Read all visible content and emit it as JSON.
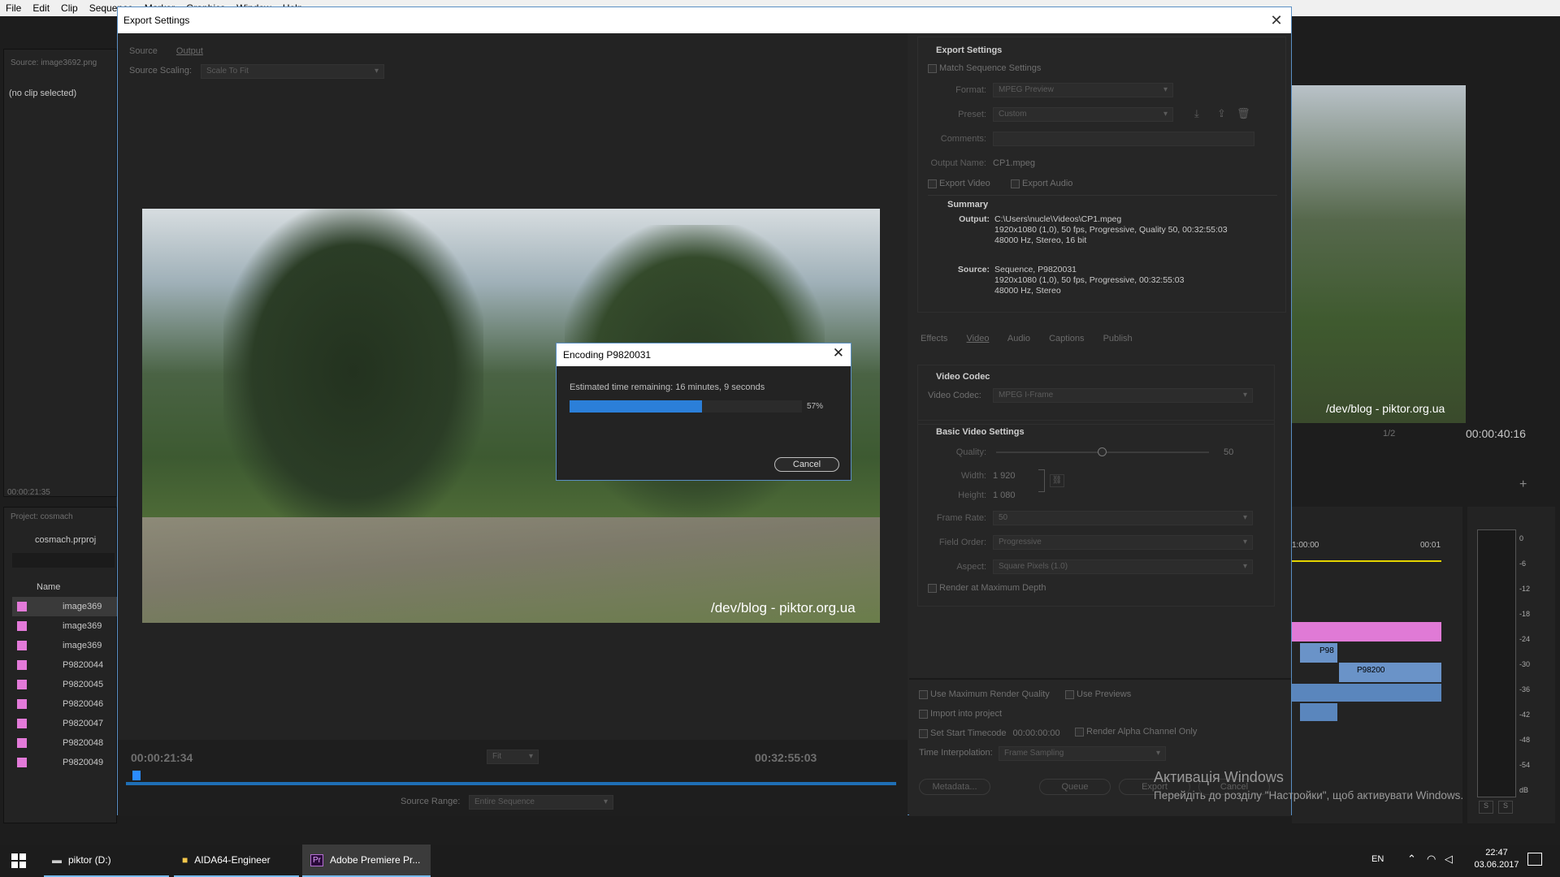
{
  "menubar": {
    "items": [
      "File",
      "Edit",
      "Clip",
      "Sequence",
      "Marker",
      "Graphics",
      "Window",
      "Help"
    ]
  },
  "background": {
    "source_label": "Source: image3692.png",
    "no_clip": "(no clip selected)",
    "left_timecode": "00:00:21:35",
    "project_label": "Project: cosmach",
    "project_file": "cosmach.prproj",
    "name_header": "Name",
    "files": [
      "image369",
      "image369",
      "image369",
      "P9820044",
      "P9820045",
      "P9820046",
      "P9820047",
      "P9820048",
      "P9820049"
    ],
    "program_timecode": "00:00:40:16",
    "program_scale": "1/2",
    "timeline_start": "1:00:00",
    "timeline_end": "00:01",
    "clip_labels": [
      "P98",
      "P98200"
    ],
    "meter_ticks": [
      "0",
      "-6",
      "-12",
      "-18",
      "-24",
      "-30",
      "-36",
      "-42",
      "-48",
      "-54",
      "dB"
    ],
    "meter_buttons": [
      "S",
      "S"
    ]
  },
  "export_dialog": {
    "title": "Export Settings",
    "tabs": [
      "Source",
      "Output"
    ],
    "source_scaling_label": "Source Scaling:",
    "source_scaling_value": "Scale To Fit",
    "preview_watermark": "/dev/blog - piktor.org.ua",
    "current_timecode": "00:00:21:34",
    "fit_label": "Fit",
    "end_timecode": "00:32:55:03",
    "source_range_label": "Source Range:",
    "source_range_value": "Entire Sequence",
    "settings": {
      "section_title": "Export Settings",
      "match_sequence": "Match Sequence Settings",
      "format_label": "Format:",
      "format_value": "MPEG Preview",
      "preset_label": "Preset:",
      "preset_value": "Custom",
      "comments_label": "Comments:",
      "output_name_label": "Output Name:",
      "output_name_value": "CP1.mpeg",
      "export_video": "Export Video",
      "export_audio": "Export Audio",
      "summary_title": "Summary",
      "output_label": "Output:",
      "output_lines": [
        "C:\\Users\\nucle\\Videos\\CP1.mpeg",
        "1920x1080 (1,0), 50 fps, Progressive, Quality 50, 00:32:55:03",
        "48000 Hz, Stereo, 16 bit"
      ],
      "source_label": "Source:",
      "source_lines": [
        "Sequence, P9820031",
        "1920x1080 (1,0), 50 fps, Progressive, 00:32:55:03",
        "48000 Hz, Stereo"
      ]
    },
    "codec_tabs": [
      "Effects",
      "Video",
      "Audio",
      "Captions",
      "Publish"
    ],
    "video_codec_title": "Video Codec",
    "video_codec_label": "Video Codec:",
    "video_codec_value": "MPEG I-Frame",
    "basic_title": "Basic Video Settings",
    "quality_label": "Quality:",
    "quality_value": "50",
    "quality_level": 0.5,
    "width_label": "Width:",
    "width_value": "1 920",
    "height_label": "Height:",
    "height_value": "1 080",
    "frame_rate_label": "Frame Rate:",
    "frame_rate_value": "50",
    "field_order_label": "Field Order:",
    "field_order_value": "Progressive",
    "aspect_label": "Aspect:",
    "aspect_value": "Square Pixels (1.0)",
    "render_max_depth": "Render at Maximum Depth",
    "use_max_render": "Use Maximum Render Quality",
    "use_previews": "Use Previews",
    "import_project": "Import into project",
    "set_start_tc": "Set Start Timecode",
    "start_tc_value": "00:00:00:00",
    "render_alpha": "Render Alpha Channel Only",
    "time_interp_label": "Time Interpolation:",
    "time_interp_value": "Frame Sampling",
    "metadata_btn": "Metadata...",
    "queue_btn": "Queue",
    "export_btn": "Export",
    "cancel_btn": "Cancel"
  },
  "encoding_dialog": {
    "title": "Encoding P9820031",
    "estimate": "Estimated time remaining: 16 minutes, 9 seconds",
    "progress": 0.57,
    "progress_label": "57%",
    "cancel": "Cancel"
  },
  "program_watermark": "/dev/blog - piktor.org.ua",
  "windows_activation": {
    "line1": "Активація Windows",
    "line2": "Перейдіть до розділу \"Настройки\", щоб активувати Windows."
  },
  "taskbar": {
    "items": [
      "piktor (D:)",
      "AIDA64-Engineer",
      "Adobe Premiere Pr..."
    ],
    "lang": "EN",
    "time": "22:47",
    "date": "03.06.2017"
  }
}
